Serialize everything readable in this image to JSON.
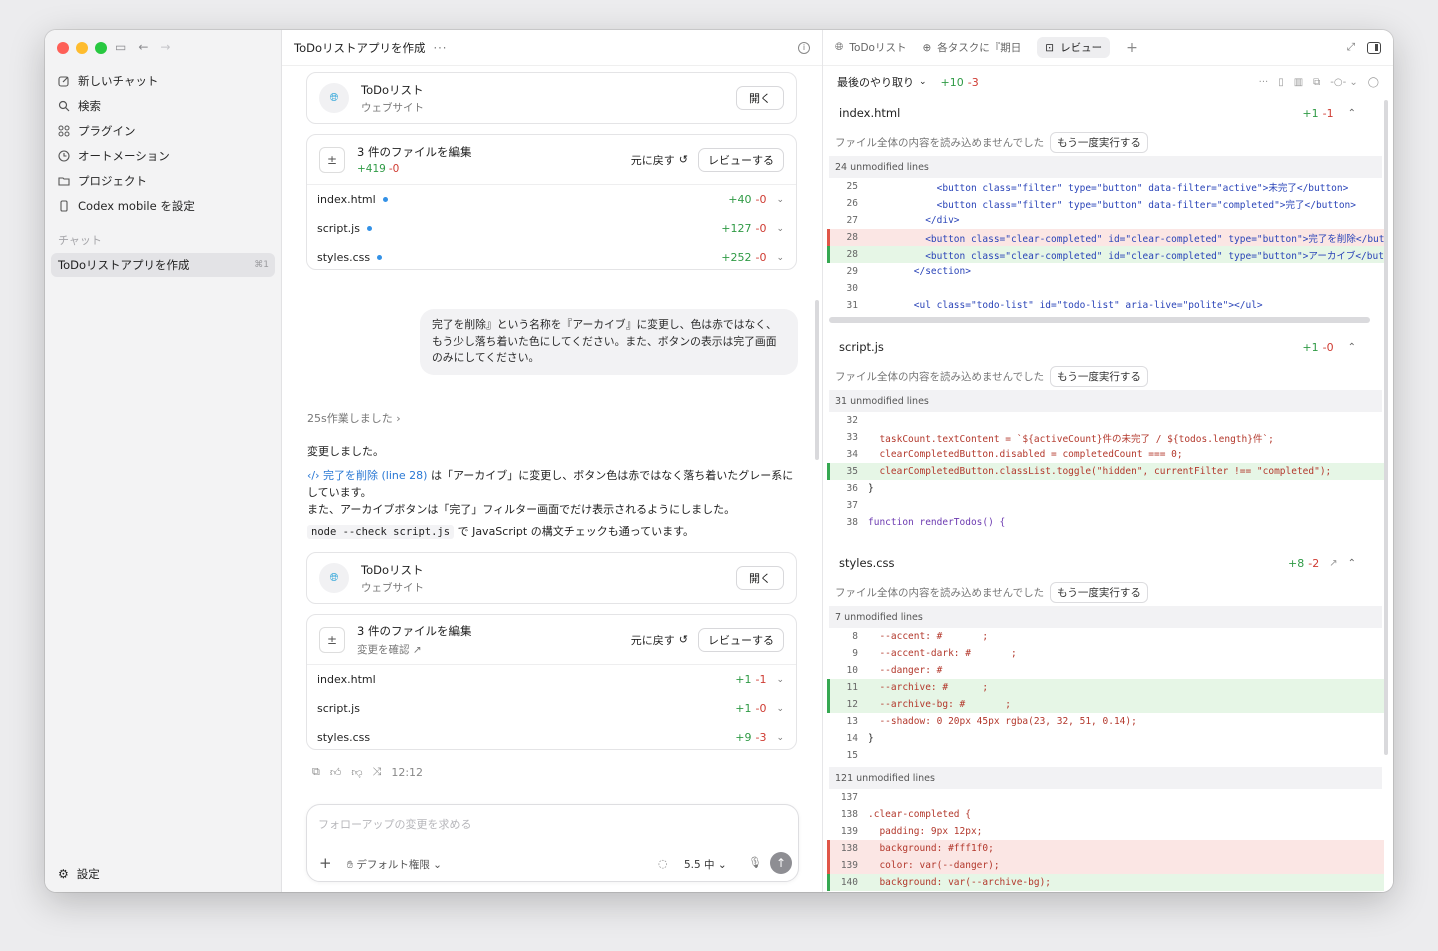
{
  "sidebar": {
    "nav": [
      {
        "label": "新しいチャット",
        "icon": "compose-icon"
      },
      {
        "label": "検索",
        "icon": "search-icon"
      },
      {
        "label": "プラグイン",
        "icon": "grid-icon"
      },
      {
        "label": "オートメーション",
        "icon": "clock-icon"
      },
      {
        "label": "プロジェクト",
        "icon": "folder-icon"
      },
      {
        "label": "Codex mobile を設定",
        "icon": "phone-icon"
      }
    ],
    "section_label": "チャット",
    "chat_item": "ToDoリストアプリを作成",
    "chat_shortcut": "⌘1",
    "settings_label": "設定"
  },
  "middle": {
    "title": "ToDoリストアプリを作成",
    "more": "···",
    "site_card_1": {
      "title": "ToDoリスト",
      "subtitle": "ウェブサイト",
      "open": "開く"
    },
    "edit_card_1": {
      "title": "3 件のファイルを編集",
      "plus": "+419",
      "minus": "-0",
      "undo": "元に戻す",
      "review": "レビューする",
      "files": [
        {
          "name": "index.html",
          "plus": "+40",
          "minus": "-0"
        },
        {
          "name": "script.js",
          "plus": "+127",
          "minus": "-0"
        },
        {
          "name": "styles.css",
          "plus": "+252",
          "minus": "-0"
        }
      ]
    },
    "user_message": "完了を削除』という名称を『アーカイブ』に変更し、色は赤ではなく、もう少し落ち着いた色にしてください。また、ボタンの表示は完了画面のみにしてください。",
    "worked": "25s作業しました",
    "reply": {
      "line1": "変更しました。",
      "link": "完了を削除 (line 28)",
      "line2": " は「アーカイブ」に変更し、ボタン色は赤ではなく落ち着いたグレー系にしています。",
      "line3": "また、アーカイブボタンは「完了」フィルター画面でだけ表示されるようにしました。",
      "code": "node --check script.js",
      "line4": " で JavaScript の構文チェックも通っています。"
    },
    "site_card_2": {
      "title": "ToDoリスト",
      "subtitle": "ウェブサイト",
      "open": "開く"
    },
    "edit_card_2": {
      "title": "3 件のファイルを編集",
      "subtitle": "変更を確認 ↗",
      "undo": "元に戻す",
      "review": "レビューする",
      "files": [
        {
          "name": "index.html",
          "plus": "+1",
          "minus": "-1"
        },
        {
          "name": "script.js",
          "plus": "+1",
          "minus": "-0"
        },
        {
          "name": "styles.css",
          "plus": "+9",
          "minus": "-3"
        }
      ]
    },
    "timestamp": "12:12",
    "composer": {
      "placeholder": "フォローアップの変更を求める",
      "permission": "デフォルト権限",
      "model": "5.5 中"
    }
  },
  "right": {
    "tabs": [
      "ToDoリスト",
      "各タスクに『期日",
      "レビュー"
    ],
    "subhead": {
      "label": "最後のやり取り",
      "plus": "+10",
      "minus": "-3"
    },
    "warn": "ファイル全体の内容を読み込めませんでした",
    "retry": "もう一度実行する",
    "files": [
      {
        "name": "index.html",
        "plus": "+1",
        "minus": "-1",
        "unmodified": "24 unmodified lines"
      },
      {
        "name": "script.js",
        "plus": "+1",
        "minus": "-0",
        "unmodified": "31 unmodified lines"
      },
      {
        "name": "styles.css",
        "plus": "+8",
        "minus": "-2",
        "unmodified": "7 unmodified lines",
        "unmodified2": "121 unmodified lines"
      }
    ],
    "html_lines": [
      {
        "n": "25",
        "t": "",
        "c": "            <button class=\"filter\" type=\"button\" data-filter=\"active\">未完了</button>"
      },
      {
        "n": "26",
        "t": "",
        "c": "            <button class=\"filter\" type=\"button\" data-filter=\"completed\">完了</button>"
      },
      {
        "n": "27",
        "t": "",
        "c": "          </div>"
      },
      {
        "n": "28",
        "t": "del",
        "c": "          <button class=\"clear-completed\" id=\"clear-completed\" type=\"button\">完了を削除</button>"
      },
      {
        "n": "28",
        "t": "add",
        "c": "          <button class=\"clear-completed\" id=\"clear-completed\" type=\"button\">アーカイブ</button>"
      },
      {
        "n": "29",
        "t": "",
        "c": "        </section>"
      },
      {
        "n": "30",
        "t": "",
        "c": ""
      },
      {
        "n": "31",
        "t": "",
        "c": "        <ul class=\"todo-list\" id=\"todo-list\" aria-live=\"polite\"></ul>"
      }
    ],
    "js_lines": [
      {
        "n": "32",
        "t": "",
        "c": ""
      },
      {
        "n": "33",
        "t": "",
        "c": "  taskCount.textContent = `${activeCount}件の未完了 / ${todos.length}件`;"
      },
      {
        "n": "34",
        "t": "",
        "c": "  clearCompletedButton.disabled = completedCount === 0;"
      },
      {
        "n": "35",
        "t": "add",
        "c": "  clearCompletedButton.classList.toggle(\"hidden\", currentFilter !== \"completed\");"
      },
      {
        "n": "36",
        "t": "",
        "c": "}"
      },
      {
        "n": "37",
        "t": "",
        "c": ""
      },
      {
        "n": "38",
        "t": "",
        "c": "function renderTodos() {"
      }
    ],
    "css_lines": [
      {
        "n": "8",
        "t": "",
        "c": "  --accent: #       ;"
      },
      {
        "n": "9",
        "t": "",
        "c": "  --accent-dark: #       ;"
      },
      {
        "n": "10",
        "t": "",
        "c": "  --danger: #"
      },
      {
        "n": "11",
        "t": "add",
        "c": "  --archive: #      ;"
      },
      {
        "n": "12",
        "t": "add",
        "c": "  --archive-bg: #       ;"
      },
      {
        "n": "13",
        "t": "",
        "c": "  --shadow: 0 20px 45px rgba(23, 32, 51, 0.14);"
      },
      {
        "n": "14",
        "t": "",
        "c": "}"
      },
      {
        "n": "15",
        "t": "",
        "c": ""
      }
    ],
    "css_lines2": [
      {
        "n": "137",
        "t": "",
        "c": ""
      },
      {
        "n": "138",
        "t": "",
        "c": ".clear-completed {"
      },
      {
        "n": "139",
        "t": "",
        "c": "  padding: 9px 12px;"
      },
      {
        "n": "138",
        "t": "del",
        "c": "  background: #fff1f0;"
      },
      {
        "n": "139",
        "t": "del",
        "c": "  color: var(--danger);"
      },
      {
        "n": "140",
        "t": "add",
        "c": "  background: var(--archive-bg);"
      }
    ]
  },
  "colors": {
    "add": "#36a852",
    "del": "#e05648",
    "link": "#2a78d4",
    "globe": "#2aa3d8"
  }
}
